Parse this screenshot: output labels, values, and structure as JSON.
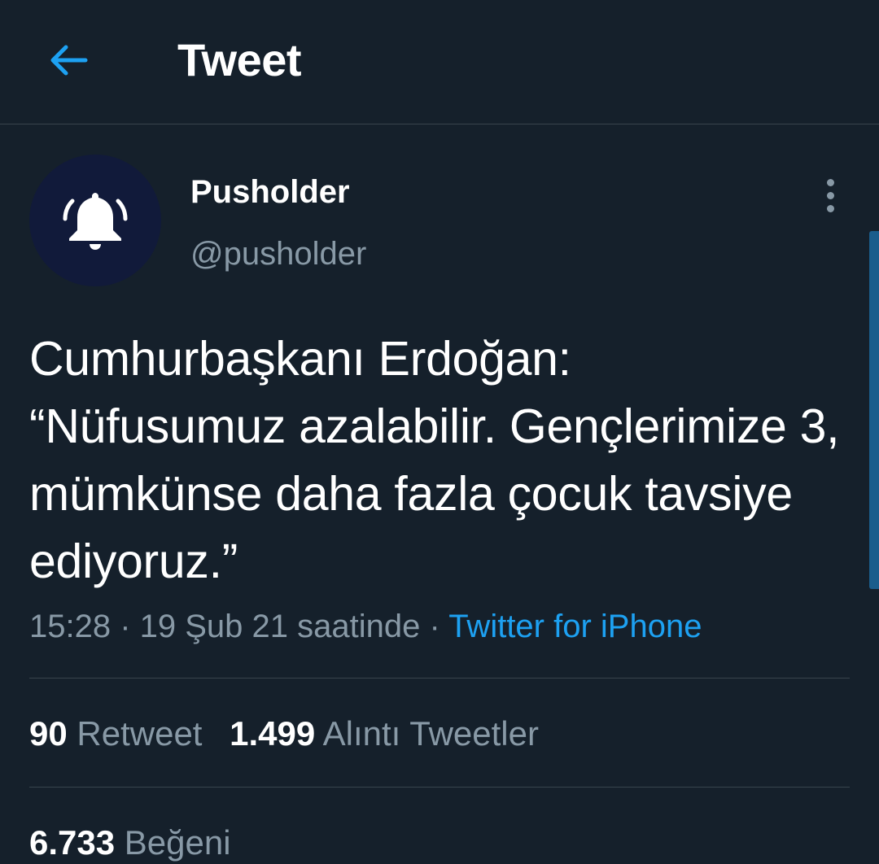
{
  "header": {
    "back_icon": "arrow-left-icon",
    "title": "Tweet"
  },
  "author": {
    "avatar_icon": "bell-ringing-icon",
    "name": "Pusholder",
    "handle": "@pusholder"
  },
  "tweet": {
    "text": "Cumhurbaşkanı Erdoğan:\n“Nüfusumuz azalabilir. Gençlerimize 3, mümkünse daha fazla çocuk tavsiye ediyoruz.”",
    "timestamp": "15:28 · 19 Şub 21 saatinde",
    "separator": " · ",
    "source": "Twitter for iPhone"
  },
  "stats": {
    "retweets_count": "90",
    "retweets_label": "Retweet",
    "quotes_count": "1.499",
    "quotes_label": "Alıntı Tweetler",
    "likes_count": "6.733",
    "likes_label": "Beğeni"
  },
  "colors": {
    "background": "#15202b",
    "accent": "#1da1f2",
    "secondary_text": "#8899a6",
    "divider": "#38444d",
    "avatar_bg": "#111a3a"
  }
}
